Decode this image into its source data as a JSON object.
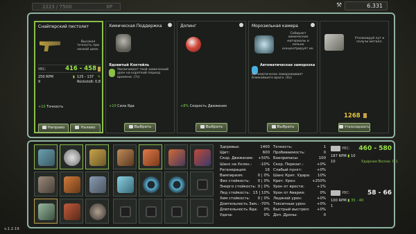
{
  "topbar": {
    "xp_value": "2223 / 7500",
    "xp_label": "XP",
    "currency": "6.331",
    "currency_icon": "hammer-icon"
  },
  "panels": [
    {
      "title": "Снайперский пистолет",
      "desc": "Высокая точность при низкой цене.",
      "dmg_label": "УВС:",
      "dmg": "416 - 458",
      "rpm": "250 RPM",
      "ammo": "125 - 137",
      "mag": "9",
      "recoil": "Rückstoß: 0,8",
      "bonus_val": "+10",
      "bonus_text": "Точность",
      "buttons": [
        "Направо",
        "Налево"
      ]
    },
    {
      "title": "Химическая Поддержка",
      "subtitle": "Ядовитый Коктейль",
      "desc": "Увеличивает твой химический урон на короткий период времени. (7s)",
      "bonus_val": "+10",
      "bonus_text": "Сила Яда",
      "button": "Выбрать"
    },
    {
      "title": "Допинг",
      "bonus_val": "+8%",
      "bonus_text": "Скорость Движения",
      "button": "Выбрать"
    },
    {
      "title": "Морозильная камера",
      "side_desc": "Собирает химические материалы и сильно концентрирует их.",
      "subtitle": "Автоматическая заморозка",
      "desc": "Автоматически замораживает ближайшего врага. (4s)",
      "button": "Выбрать"
    },
    {
      "side_desc": "Утилизируй лут и получи металл.",
      "value": "1268",
      "button": "Утилизировать"
    }
  ],
  "stats_left": [
    {
      "k": "Здоровье:",
      "v": "1400",
      "c": "g"
    },
    {
      "k": "Щит:",
      "v": "600",
      "c": "g"
    },
    {
      "k": "Скор. Движения:",
      "v": "+50%",
      "c": "g"
    },
    {
      "k": "Шанс на Уклон.:",
      "v": "-10%",
      "c": "r"
    },
    {
      "k": "Регенерация:",
      "v": "16",
      "c": "g"
    },
    {
      "k": "Вампиризм:",
      "v": "0 | 0%",
      "c": ""
    },
    {
      "k": "Физ стойкость:",
      "v": "0 | 0%",
      "c": ""
    },
    {
      "k": "Энерго стойкость:",
      "v": "0 | 0%",
      "c": ""
    },
    {
      "k": "Лед стойкость:",
      "v": "15 | 10%",
      "c": ""
    },
    {
      "k": "Хим стойкость:",
      "v": "0 | 0%",
      "c": ""
    },
    {
      "k": "Длительность Зам.:",
      "v": "-70%",
      "c": "g"
    },
    {
      "k": "Длительность Яда:",
      "v": "0%",
      "c": ""
    },
    {
      "k": "Удача:",
      "v": "0%",
      "c": ""
    }
  ],
  "stats_right": [
    {
      "k": "Точность:",
      "v": "1",
      "c": ""
    },
    {
      "k": "Пробиваемость:",
      "v": "0",
      "c": ""
    },
    {
      "k": "Боеприпасы:",
      "v": "100",
      "c": ""
    },
    {
      "k": "Скор. Перезаг.:",
      "v": "+0%",
      "c": ""
    },
    {
      "k": "Слабый пункт:",
      "v": "+0%",
      "c": ""
    },
    {
      "k": "Шанс Крит. Удара:",
      "v": "10%",
      "c": ""
    },
    {
      "k": "Крит. Урон:",
      "v": "+250%",
      "c": ""
    },
    {
      "k": "Урон от ярости:",
      "v": "+1%",
      "c": "g"
    },
    {
      "k": "Урон от Аварии:",
      "v": "0%",
      "c": ""
    },
    {
      "k": "Ледяной урон:",
      "v": "+0%",
      "c": ""
    },
    {
      "k": "Токсичные урон:",
      "v": "+0%",
      "c": ""
    },
    {
      "k": "Быстрый выстрел:",
      "v": "+0%",
      "c": ""
    },
    {
      "k": "Доп. Дроны:",
      "v": "0",
      "c": ""
    }
  ],
  "weapon1": {
    "dmg_label": "УВС:",
    "dmg": "460 - 580",
    "rpm": "187 RPM",
    "ammo": "10",
    "mag": "10",
    "special": "Ударная Волна: 0.1"
  },
  "weapon2": {
    "dmg_label": "УВС:",
    "dmg": "58 - 66",
    "rpm": "100 RPM",
    "ammo": "35 - 40",
    "mag": "1"
  },
  "version": "v.1.2.19"
}
